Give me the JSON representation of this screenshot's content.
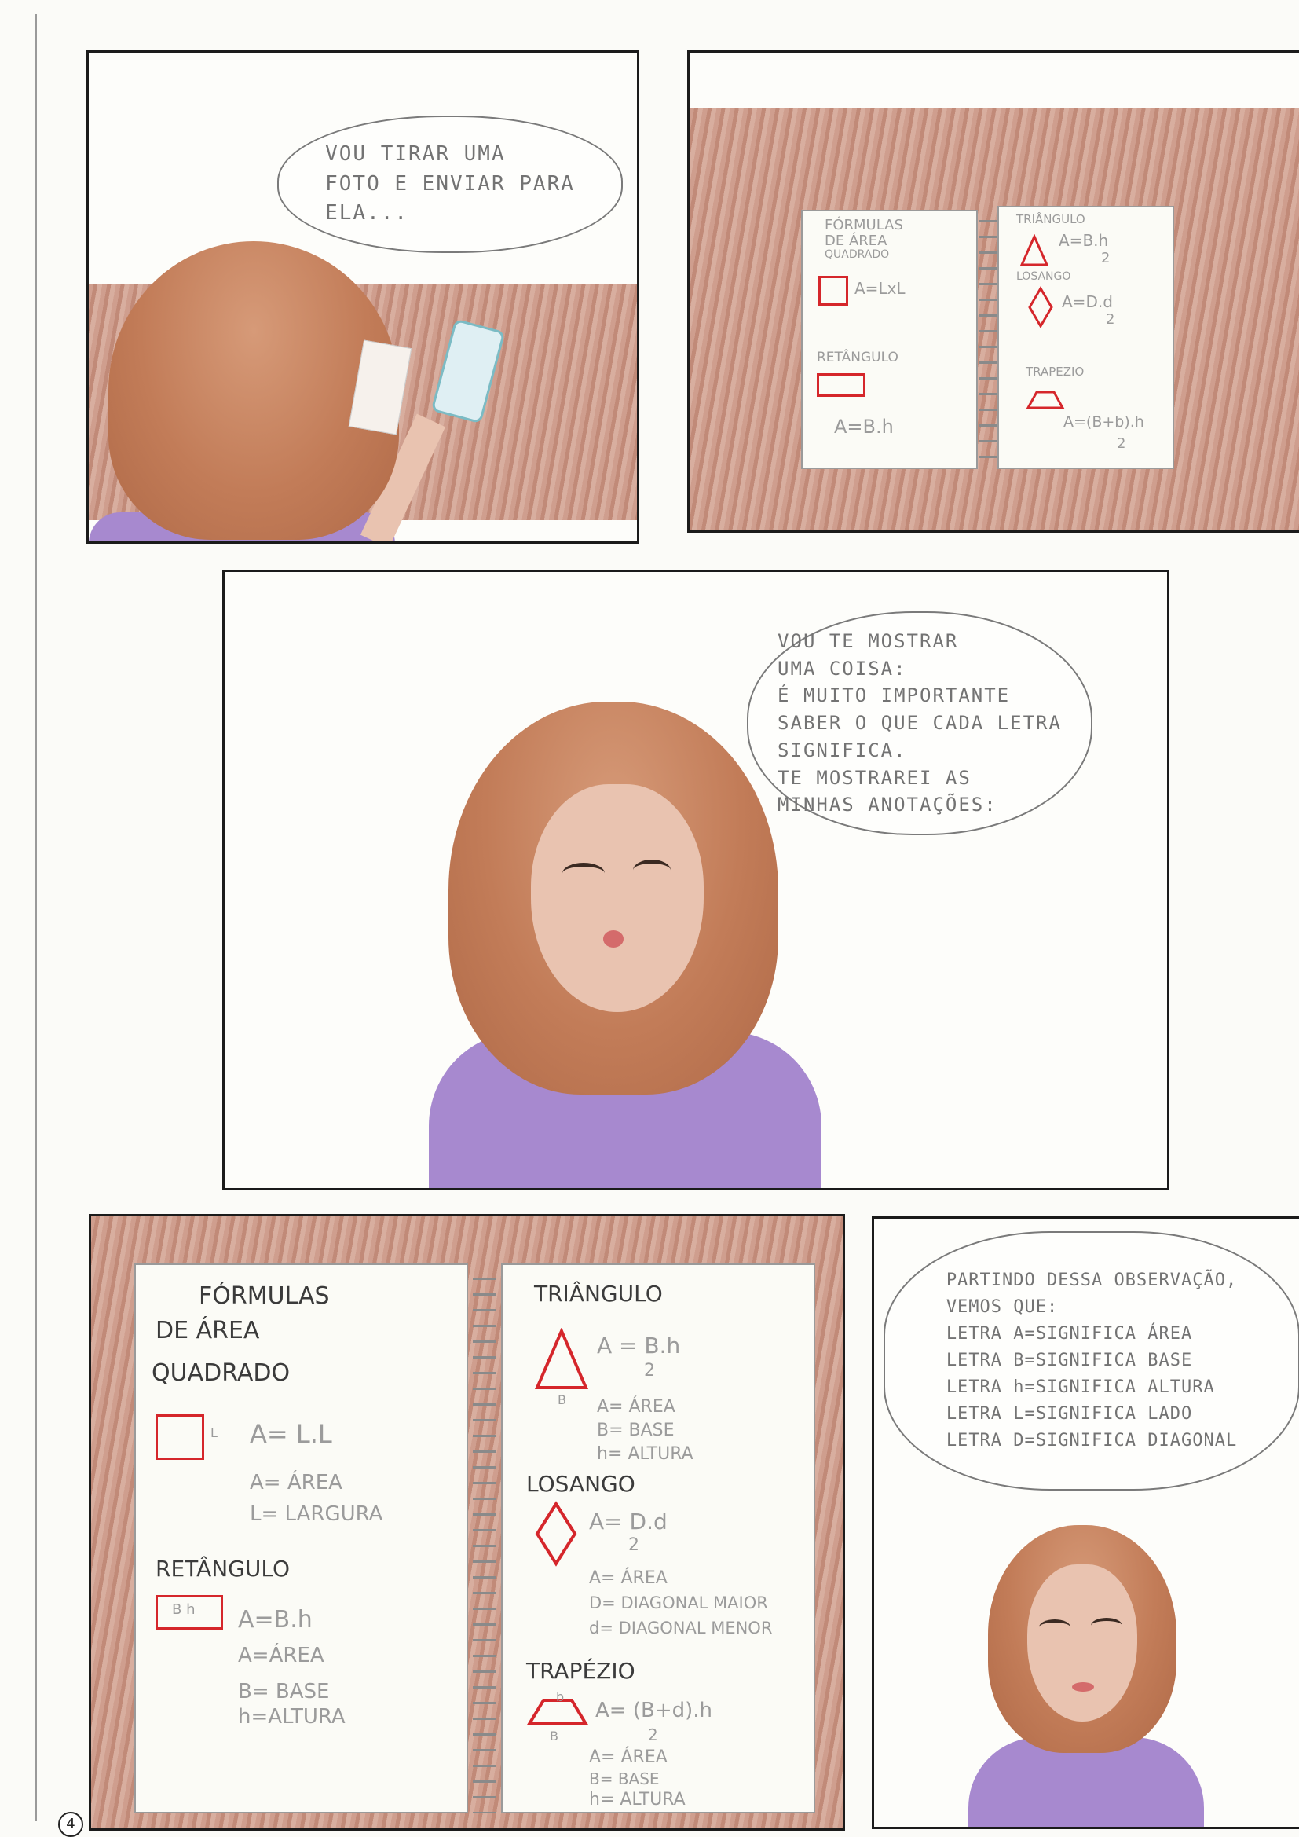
{
  "page_number": "4",
  "panel1": {
    "speech": [
      "VOU TIRAR UMA",
      "FOTO E ENVIAR PARA",
      "ELA..."
    ]
  },
  "panel2": {
    "left_page": {
      "title": [
        "FÓRMULAS",
        "DE ÁREA"
      ],
      "quadrado": "QUADRADO",
      "quadrado_formula": "A=LxL",
      "retangulo": "RETÂNGULO",
      "retangulo_formula": "A=B.h"
    },
    "right_page": {
      "triangulo": "TRIÂNGULO",
      "triangulo_formula_num": "A=B.h",
      "triangulo_formula_den": "2",
      "losango": "LOSANGO",
      "losango_formula_num": "A=D.d",
      "losango_formula_den": "2",
      "trapezio": "TRAPEZIO",
      "trapezio_formula_num": "A=(B+b).h",
      "trapezio_formula_den": "2"
    }
  },
  "panel3": {
    "speech": [
      "VOU TE MOSTRAR",
      "UMA COISA:",
      "É MUITO IMPORTANTE",
      "SABER O QUE CADA LETRA",
      "SIGNIFICA.",
      "TE MOSTRAREI AS",
      "MINHAS ANOTAÇÕES:"
    ]
  },
  "panel4": {
    "left_page": {
      "title": [
        "FÓRMULAS",
        "DE ÁREA"
      ],
      "quadrado": "QUADRADO",
      "quadrado_side": "L",
      "quadrado_formula": "A= L.L",
      "quadrado_legend": [
        "A= ÁREA",
        "L= LARGURA"
      ],
      "retangulo": "RETÂNGULO",
      "retangulo_inner": "B h",
      "retangulo_formula": "A=B.h",
      "retangulo_legend": [
        "A=ÁREA",
        "B= BASE",
        "h=ALTURA"
      ]
    },
    "right_page": {
      "triangulo": "TRIÂNGULO",
      "triangulo_base": "B",
      "triangulo_formula_num": "A = B.h",
      "triangulo_formula_den": "2",
      "triangulo_legend": [
        "A= ÁREA",
        "B= BASE",
        "h= ALTURA"
      ],
      "losango": "LOSANGO",
      "losango_formula_num": "A= D.d",
      "losango_formula_den": "2",
      "losango_legend": [
        "A= ÁREA",
        "D= DIAGONAL MAIOR",
        "d= DIAGONAL MENOR"
      ],
      "trapezio": "TRAPÉZIO",
      "trapezio_top": "b",
      "trapezio_base": "B",
      "trapezio_formula_num": "A= (B+d).h",
      "trapezio_formula_den": "2",
      "trapezio_legend": [
        "A= ÁREA",
        "B= BASE",
        "h= ALTURA"
      ]
    }
  },
  "panel5": {
    "speech": [
      "PARTINDO DESSA OBSERVAÇÃO,",
      "VEMOS QUE:",
      "LETRA A=SIGNIFICA ÁREA",
      "LETRA B=SIGNIFICA BASE",
      "LETRA h=SIGNIFICA ALTURA",
      "LETRA L=SIGNIFICA LADO",
      "LETRA D=SIGNIFICA DIAGONAL"
    ]
  },
  "colors": {
    "red": "#d5262b",
    "hair": "#c27c58",
    "shirt": "#a789cf",
    "wood": "#c9957f",
    "frame": "#1b1b1b"
  }
}
